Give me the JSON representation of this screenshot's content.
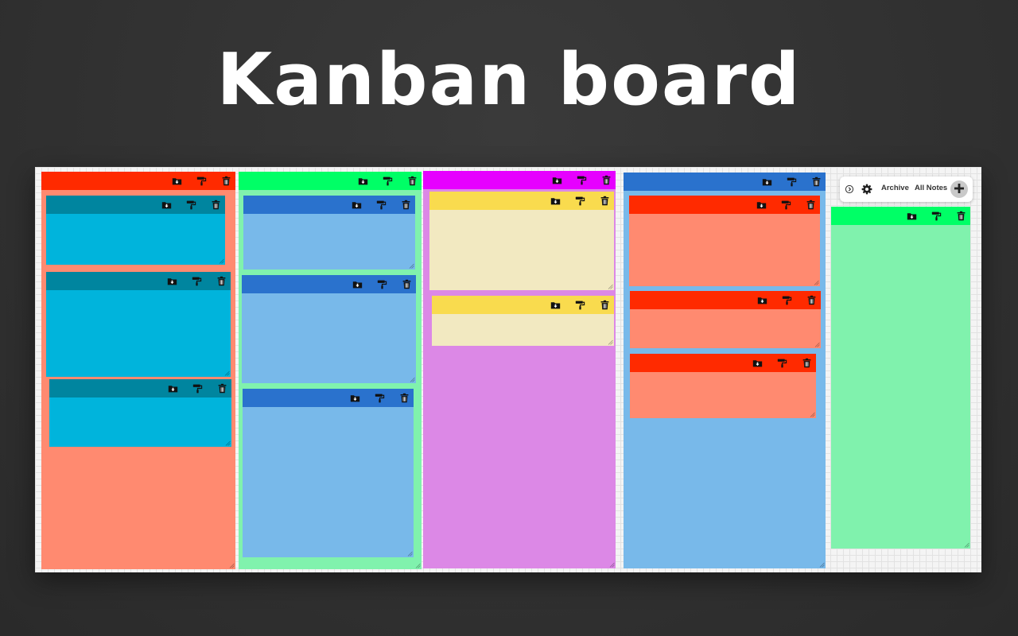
{
  "title": "Kanban board",
  "sidebar": {
    "archive_label": "Archive",
    "all_notes_label": "All Notes"
  },
  "colors": {
    "page_background": "#333333",
    "board_background": "#f4f4f4",
    "icon": "#111111"
  },
  "icons": {
    "archive": "archive-folder-icon",
    "paint": "paint-roller-icon",
    "delete": "trash-icon",
    "collapse": "chevron-circle-icon",
    "settings": "gear-icon",
    "add": "plus-icon"
  },
  "columns": [
    {
      "header_color": "#ff2a00",
      "body_color": "#ff8a70",
      "notes": [
        {
          "header_color": "#00859f",
          "body_color": "#00b4dc"
        },
        {
          "header_color": "#00859f",
          "body_color": "#00b4dc"
        },
        {
          "header_color": "#00859f",
          "body_color": "#00b4dc"
        }
      ]
    },
    {
      "header_color": "#00ff66",
      "body_color": "#80f2ad",
      "notes": [
        {
          "header_color": "#2a72cd",
          "body_color": "#78b9ea"
        },
        {
          "header_color": "#2a72cd",
          "body_color": "#78b9ea"
        },
        {
          "header_color": "#2a72cd",
          "body_color": "#78b9ea"
        }
      ]
    },
    {
      "header_color": "#e600ff",
      "body_color": "#dc88e6",
      "notes": [
        {
          "header_color": "#f9db4e",
          "body_color": "#f2e9c1"
        },
        {
          "header_color": "#f9db4e",
          "body_color": "#f2e9c1"
        }
      ]
    },
    {
      "header_color": "#2a72cd",
      "body_color": "#78b9ea",
      "notes": [
        {
          "header_color": "#ff2a00",
          "body_color": "#ff8a70"
        },
        {
          "header_color": "#ff2a00",
          "body_color": "#ff8a70"
        },
        {
          "header_color": "#ff2a00",
          "body_color": "#ff8a70"
        }
      ]
    }
  ],
  "sidebar_note": {
    "header_color": "#00ff66",
    "body_color": "#80f2ad"
  }
}
